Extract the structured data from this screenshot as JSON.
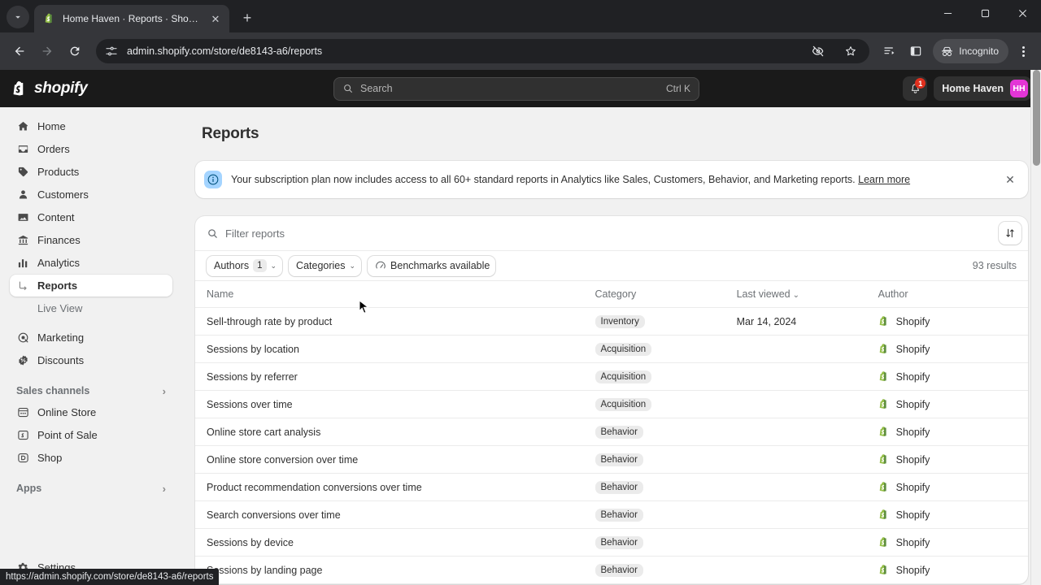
{
  "browser": {
    "tab": {
      "title": "Home Haven · Reports · Shopify",
      "close_label": "✕"
    },
    "newtab_label": "+",
    "url": "admin.shopify.com/store/de8143-a6/reports",
    "incognito_label": "Incognito",
    "status_url": "https://admin.shopify.com/store/de8143-a6/reports"
  },
  "topbar": {
    "brand": "shopify",
    "search_placeholder": "Search",
    "search_shortcut": "Ctrl K",
    "notification_count": "1",
    "store_name": "Home Haven",
    "avatar_initials": "HH"
  },
  "sidebar": {
    "items": [
      {
        "label": "Home",
        "icon": "home-icon"
      },
      {
        "label": "Orders",
        "icon": "orders-icon"
      },
      {
        "label": "Products",
        "icon": "products-tag-icon"
      },
      {
        "label": "Customers",
        "icon": "customers-person-icon"
      },
      {
        "label": "Content",
        "icon": "content-icon"
      },
      {
        "label": "Finances",
        "icon": "finances-bank-icon"
      },
      {
        "label": "Analytics",
        "icon": "analytics-bars-icon"
      }
    ],
    "sub_items": [
      {
        "label": "Reports",
        "active": true
      },
      {
        "label": "Live View",
        "active": false
      }
    ],
    "items_after": [
      {
        "label": "Marketing",
        "icon": "marketing-icon"
      },
      {
        "label": "Discounts",
        "icon": "discounts-icon"
      }
    ],
    "sales_channels_label": "Sales channels",
    "channels": [
      {
        "label": "Online Store",
        "icon": "online-store-icon"
      },
      {
        "label": "Point of Sale",
        "icon": "point-of-sale-icon"
      },
      {
        "label": "Shop",
        "icon": "shop-icon"
      }
    ],
    "apps_label": "Apps",
    "settings_label": "Settings"
  },
  "main": {
    "page_title": "Reports",
    "banner": {
      "text": "Your subscription plan now includes access to all 60+ standard reports in Analytics like Sales, Customers, Behavior, and Marketing reports.",
      "link": "Learn more",
      "close_label": "✕"
    },
    "filter_placeholder": "Filter reports",
    "chips": [
      {
        "label": "Authors",
        "count": "1",
        "chevron": "⌄"
      },
      {
        "label": "Categories",
        "count": "",
        "chevron": "⌄"
      },
      {
        "label": "Benchmarks available",
        "count": "",
        "chevron": ""
      }
    ],
    "results_text": "93 results",
    "table": {
      "columns": [
        "Name",
        "Category",
        "Last viewed",
        "Author"
      ],
      "sort_indicator": "⌄",
      "rows": [
        {
          "name": "Sell-through rate by product",
          "category": "Inventory",
          "last_viewed": "Mar 14, 2024",
          "author": "Shopify"
        },
        {
          "name": "Sessions by location",
          "category": "Acquisition",
          "last_viewed": "",
          "author": "Shopify"
        },
        {
          "name": "Sessions by referrer",
          "category": "Acquisition",
          "last_viewed": "",
          "author": "Shopify"
        },
        {
          "name": "Sessions over time",
          "category": "Acquisition",
          "last_viewed": "",
          "author": "Shopify"
        },
        {
          "name": "Online store cart analysis",
          "category": "Behavior",
          "last_viewed": "",
          "author": "Shopify"
        },
        {
          "name": "Online store conversion over time",
          "category": "Behavior",
          "last_viewed": "",
          "author": "Shopify"
        },
        {
          "name": "Product recommendation conversions over time",
          "category": "Behavior",
          "last_viewed": "",
          "author": "Shopify"
        },
        {
          "name": "Search conversions over time",
          "category": "Behavior",
          "last_viewed": "",
          "author": "Shopify"
        },
        {
          "name": "Sessions by device",
          "category": "Behavior",
          "last_viewed": "",
          "author": "Shopify"
        },
        {
          "name": "Sessions by landing page",
          "category": "Behavior",
          "last_viewed": "",
          "author": "Shopify"
        }
      ]
    }
  },
  "colors": {
    "brand_dark": "#1a1a1a",
    "avatar": "#e335d6",
    "badge_red": "#e0301e",
    "banner_icon_bg": "#a4d4ff",
    "shopify_green": "#95bf47"
  }
}
